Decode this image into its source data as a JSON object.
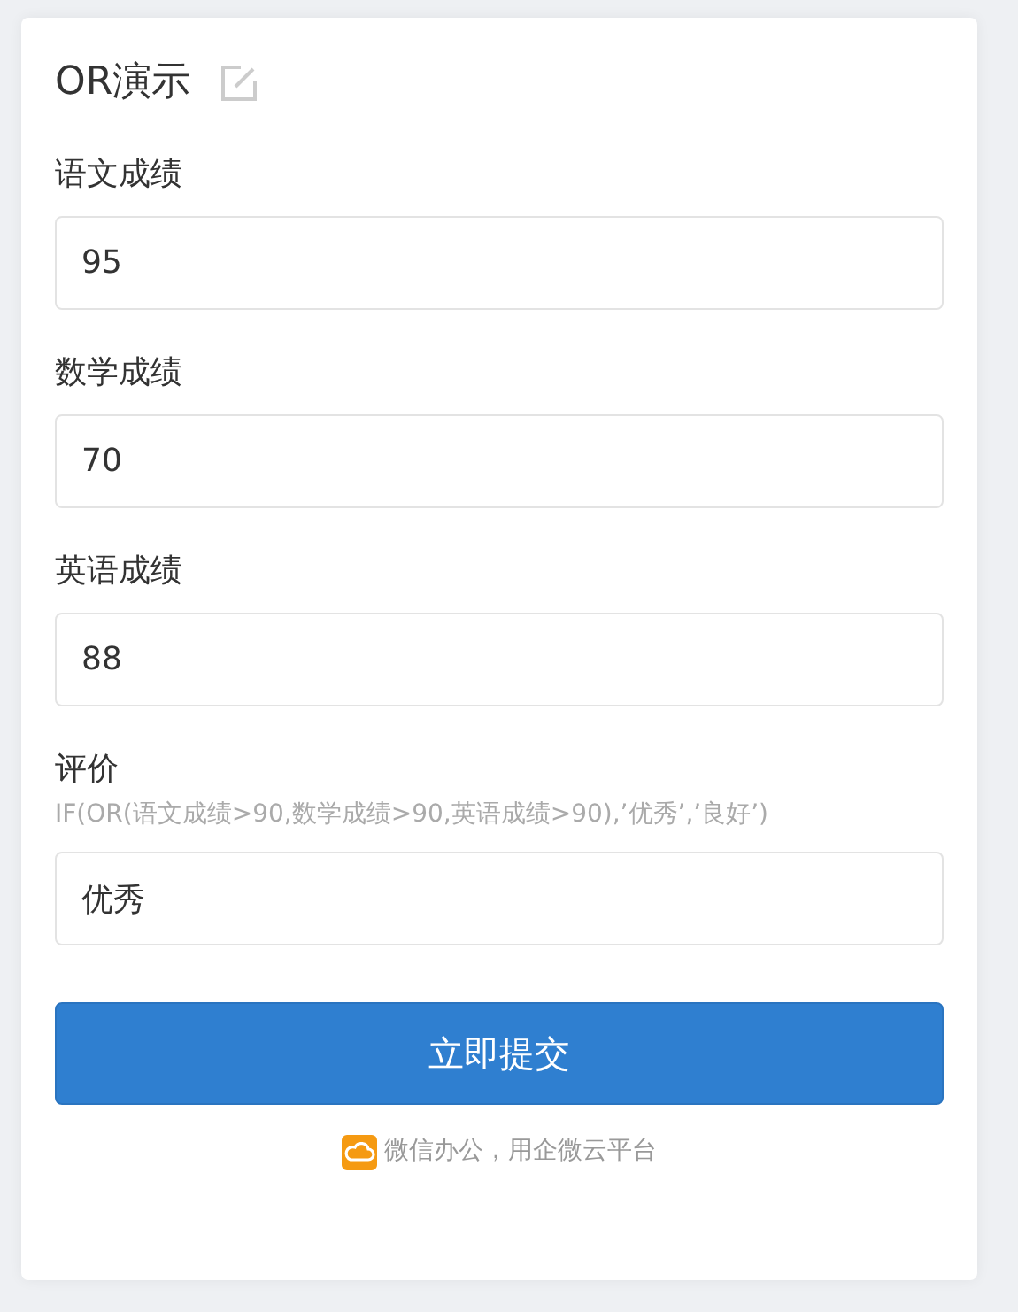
{
  "form": {
    "title": "OR演示",
    "fields": [
      {
        "label": "语文成绩",
        "value": "95"
      },
      {
        "label": "数学成绩",
        "value": "70"
      },
      {
        "label": "英语成绩",
        "value": "88"
      },
      {
        "label": "评价",
        "hint": "IF(OR(语文成绩>90,数学成绩>90,英语成绩>90),’优秀’,’良好’)",
        "value": "优秀"
      }
    ],
    "submit": "立即提交",
    "footer": "微信办公，用企微云平台"
  }
}
